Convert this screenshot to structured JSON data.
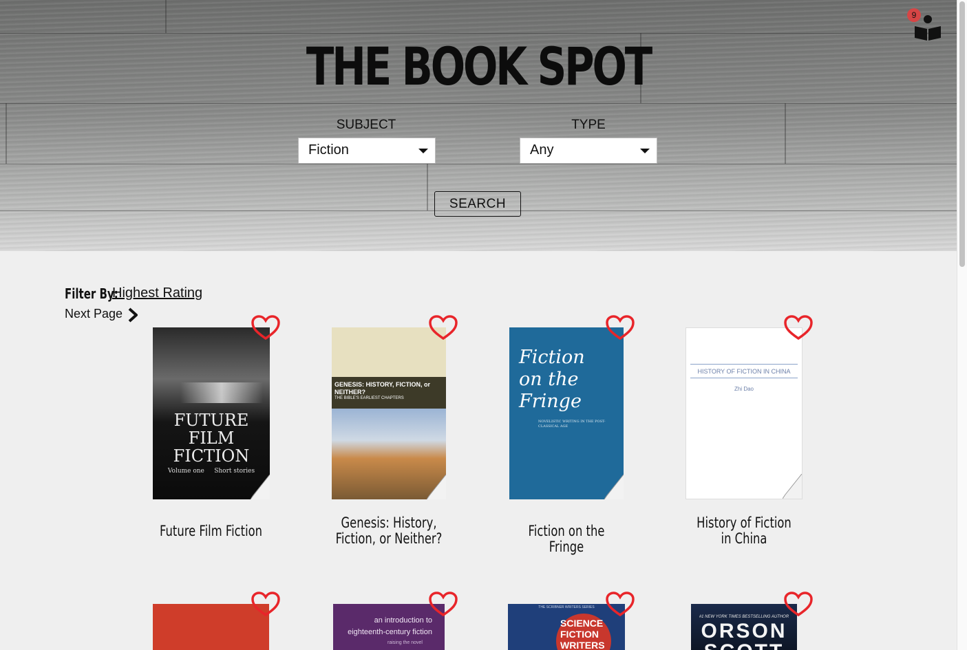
{
  "header": {
    "site_title": "THE BOOK SPOT",
    "cart_count": "9",
    "cart_icon": "reader-icon"
  },
  "search": {
    "subject_label": "SUBJECT",
    "subject_value": "Fiction",
    "type_label": "TYPE",
    "type_value": "Any",
    "search_label": "SEARCH"
  },
  "results": {
    "filter_label": "Filter By:",
    "filter_value": "Highest Rating",
    "next_page_label": "Next Page",
    "books": [
      {
        "title": "Future Film Fiction",
        "cover_text": "FUTURE FILM FICTION",
        "cover_sub": "Volume one     Short stories"
      },
      {
        "title": "Genesis: History, Fiction, or Neither?",
        "cover_text": "GENESIS: HISTORY, FICTION, or NEITHER?",
        "cover_sub": "THE BIBLE'S EARLIEST CHAPTERS"
      },
      {
        "title": "Fiction on the Fringe",
        "cover_text": "Fiction on the Fringe",
        "cover_sub": "NOVELISTIC WRITING IN THE POST-CLASSICAL AGE"
      },
      {
        "title": "History of Fiction in China",
        "cover_text": "HISTORY OF FICTION IN CHINA",
        "cover_sub": "Zhi Dao"
      },
      {
        "title": "",
        "cover_text": "",
        "cover_sub": ""
      },
      {
        "title": "",
        "cover_text": "an introduction to eighteenth-century fiction",
        "cover_sub": "raising the novel"
      },
      {
        "title": "",
        "cover_text": "SCIENCE FICTION WRITERS",
        "cover_sub": "THE SCRIBNER WRITERS SERIES"
      },
      {
        "title": "",
        "cover_text": "ORSON SCOTT",
        "cover_sub": "#1 NEW YORK TIMES BESTSELLING AUTHOR"
      }
    ]
  },
  "colors": {
    "heart": "#e8252a",
    "badge": "#d64545",
    "background": "#efefef"
  }
}
